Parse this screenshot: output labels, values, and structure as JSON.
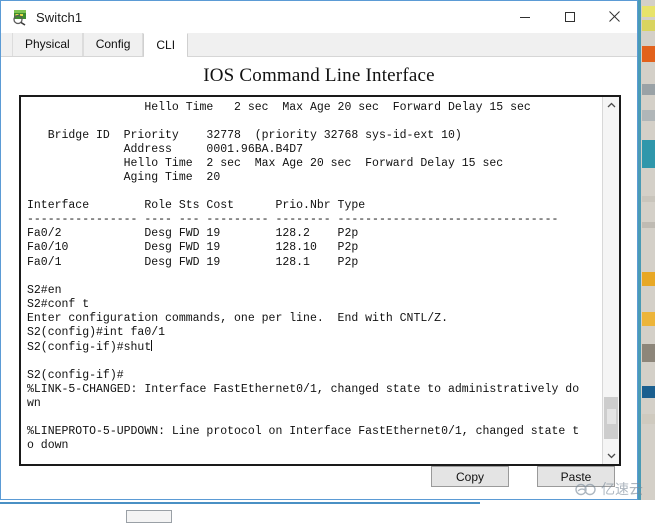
{
  "window": {
    "title": "Switch1",
    "icon": "switch-device-icon",
    "controls": {
      "minimize": "minimize-icon",
      "maximize": "maximize-icon",
      "close": "close-icon"
    },
    "border_color": "#5b9bd5"
  },
  "tabs": [
    {
      "label": "Physical",
      "active": false
    },
    {
      "label": "Config",
      "active": false
    },
    {
      "label": "CLI",
      "active": true
    }
  ],
  "heading": "IOS Command Line Interface",
  "terminal": {
    "text": "                 Hello Time   2 sec  Max Age 20 sec  Forward Delay 15 sec\n\n   Bridge ID  Priority    32778  (priority 32768 sys-id-ext 10)\n              Address     0001.96BA.B4D7\n              Hello Time  2 sec  Max Age 20 sec  Forward Delay 15 sec\n              Aging Time  20\n\nInterface        Role Sts Cost      Prio.Nbr Type\n---------------- ---- --- --------- -------- --------------------------------\nFa0/2            Desg FWD 19        128.2    P2p\nFa0/10           Desg FWD 19        128.10   P2p\nFa0/1            Desg FWD 19        128.1    P2p\n\nS2#en\nS2#conf t\nEnter configuration commands, one per line.  End with CNTL/Z.\nS2(config)#int fa0/1\nS2(config-if)#shut",
    "text_after_caret": "\n\nS2(config-if)#\n%LINK-5-CHANGED: Interface FastEthernet0/1, changed state to administratively do\nwn\n\n%LINEPROTO-5-UPDOWN: Line protocol on Interface FastEthernet0/1, changed state t\no down",
    "cursor_visible": true,
    "scrollbar": {
      "up_arrow": "chevron-up-icon",
      "down_arrow": "chevron-down-icon",
      "thumb_position_percent": 86
    }
  },
  "buttons": {
    "copy": "Copy",
    "paste": "Paste"
  },
  "watermark": {
    "text": "亿速云",
    "logo": "cloud-icon",
    "color": "#7b8a99"
  }
}
